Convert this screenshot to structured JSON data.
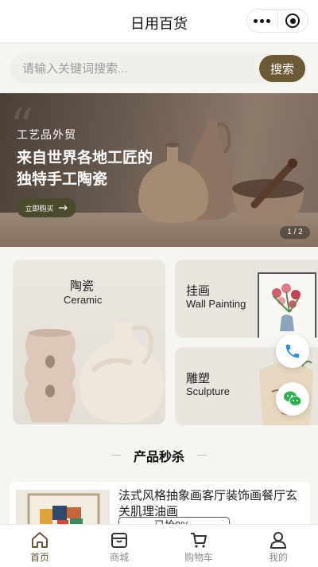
{
  "header": {
    "title": "日用百货"
  },
  "search": {
    "placeholder": "请输入关键词搜索...",
    "button_label": "搜索"
  },
  "banner": {
    "kicker": "工艺品外贸",
    "headline_line1": "来自世界各地工匠的",
    "headline_line2": "独特手工陶瓷",
    "buy_label": "立即购买",
    "indicator": "1 / 2"
  },
  "categories": [
    {
      "cn": "陶瓷",
      "en": "Ceramic"
    },
    {
      "cn": "挂画",
      "en": "Wall Painting"
    },
    {
      "cn": "雕塑",
      "en": "Sculpture"
    }
  ],
  "section": {
    "title": "产品秒杀"
  },
  "product": {
    "name": "法式风格抽象画客厅装饰画餐厅玄关肌理油画",
    "sold": "已抢0%"
  },
  "tabbar": [
    {
      "label": "首页",
      "icon": "home-icon",
      "active": true
    },
    {
      "label": "商城",
      "icon": "store-icon",
      "active": false
    },
    {
      "label": "购物车",
      "icon": "cart-icon",
      "active": false
    },
    {
      "label": "我的",
      "icon": "user-icon",
      "active": false
    }
  ],
  "colors": {
    "accent": "#6b5a35",
    "background": "#f6f5f1",
    "card": "#e9e5df",
    "phone": "#2f8ee8",
    "wechat": "#2bb24c"
  }
}
